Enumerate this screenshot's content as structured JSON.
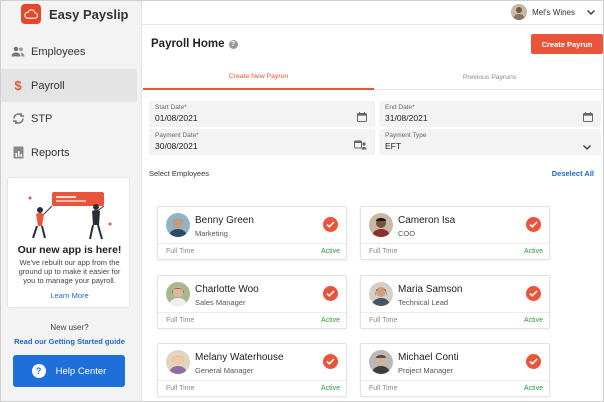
{
  "app": {
    "name": "Easy Payslip"
  },
  "sidebar": {
    "items": [
      {
        "label": "Employees",
        "icon": "people-icon"
      },
      {
        "label": "Payroll",
        "icon": "dollar-icon"
      },
      {
        "label": "STP",
        "icon": "sync-icon"
      },
      {
        "label": "Reports",
        "icon": "report-icon"
      }
    ],
    "active": "Payroll",
    "promo": {
      "title": "Our new app is here!",
      "text": "We've rebuilt our app from the ground up to make it easier for you to manage your payroll.",
      "link": "Learn More"
    },
    "new_user": "New user?",
    "guide_link": "Read our Getting Started guide",
    "help_button": "Help Center"
  },
  "topbar": {
    "account_name": "Mel's Wines"
  },
  "header": {
    "title": "Payroll Home",
    "create_button": "Create Payrun"
  },
  "tabs": [
    {
      "label": "Create New Payrun",
      "active": true
    },
    {
      "label": "Previous Payruns",
      "active": false
    }
  ],
  "form": {
    "start_date": {
      "label": "Start Date*",
      "value": "01/08/2021"
    },
    "end_date": {
      "label": "End Date*",
      "value": "31/08/2021"
    },
    "payment_date": {
      "label": "Payment Date*",
      "value": "30/08/2021"
    },
    "payment_type": {
      "label": "Payment Type",
      "value": "EFT"
    }
  },
  "employees_section": {
    "label": "Select Employees",
    "deselect": "Deselect All"
  },
  "employees": [
    {
      "name": "Benny Green",
      "role": "Marketing",
      "type": "Full Time",
      "status": "Active"
    },
    {
      "name": "Cameron Isa",
      "role": "COO",
      "type": "Full Time",
      "status": "Active"
    },
    {
      "name": "Charlotte Woo",
      "role": "Sales Manager",
      "type": "Full Time",
      "status": "Active"
    },
    {
      "name": "Maria Samson",
      "role": "Technical Lead",
      "type": "Full Time",
      "status": "Active"
    },
    {
      "name": "Melany Waterhouse",
      "role": "General Manager",
      "type": "Full Time",
      "status": "Active"
    },
    {
      "name": "Michael Conti",
      "role": "Project Manager",
      "type": "Full Time",
      "status": "Active"
    }
  ],
  "colors": {
    "accent": "#e8553a",
    "link": "#1e68c7",
    "help_button": "#1e6fd9",
    "active_status": "#2f9b3f"
  }
}
